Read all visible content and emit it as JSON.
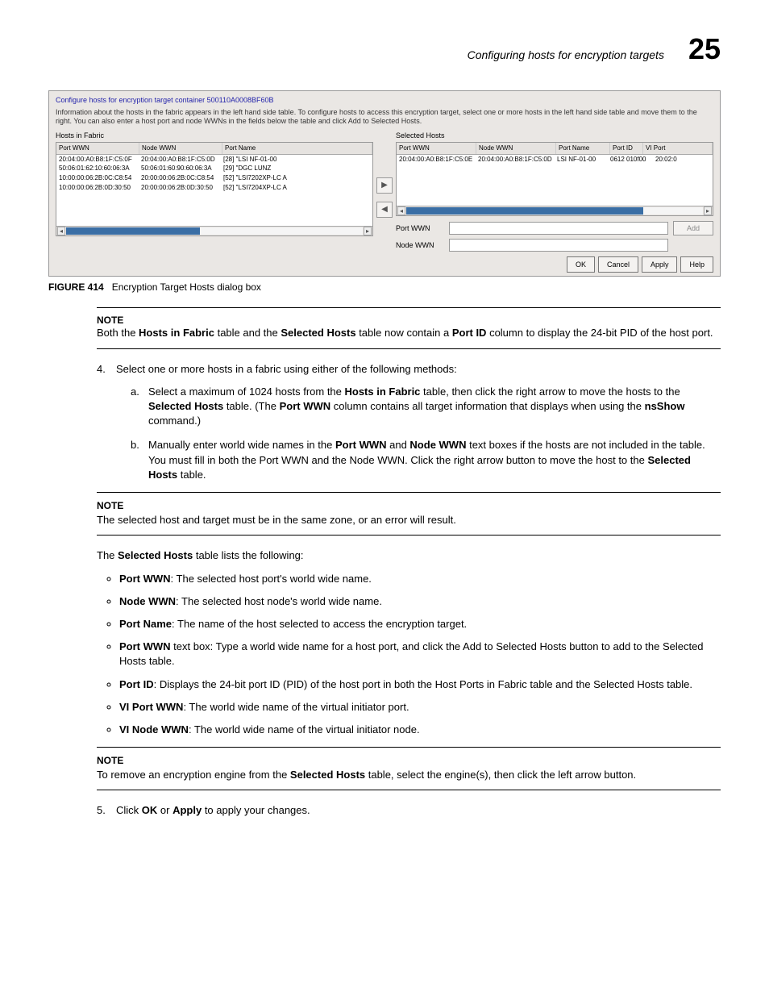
{
  "header": {
    "title": "Configuring hosts for encryption targets",
    "chapter": "25"
  },
  "dialog": {
    "container_line": "Configure hosts for encryption target container 500110A0008BF60B",
    "info_line": "Information about the hosts in the fabric appears in the left hand side table. To configure hosts to access this encryption target, select one or more hosts in the left hand side table and move them to the right. You can also enter a host port and node WWNs in the fields below the table and click Add to Selected Hosts.",
    "left": {
      "label": "Hosts in Fabric",
      "headers": [
        "Port WWN",
        "Node WWN",
        "Port Name"
      ],
      "rows": [
        [
          "20:04:00:A0:B8:1F:C5:0F",
          "20:04:00:A0:B8:1F:C5:0D",
          "[28] \"LSI    NF-01-00"
        ],
        [
          "50:06:01:62:10:60:06:3A",
          "50:06:01:60:90:60:06:3A",
          "[29] \"DGC   LUNZ"
        ],
        [
          "10:00:00:06:2B:0C:C8:54",
          "20:00:00:06:2B:0C:C8:54",
          "[52] \"LSI7202XP-LC A"
        ],
        [
          "10:00:00:06:2B:0D:30:50",
          "20:00:00:06:2B:0D:30:50",
          "[52] \"LSI7204XP-LC A"
        ]
      ]
    },
    "right": {
      "label": "Selected Hosts",
      "headers": [
        "Port WWN",
        "Node WWN",
        "Port Name",
        "Port ID",
        "VI Port"
      ],
      "rows": [
        [
          "20:04:00:A0:B8:1F:C5:0E",
          "20:04:00:A0:B8:1F:C5:0D",
          "LSI    NF-01-00",
          "0612   010f00",
          "20:02:0"
        ]
      ]
    },
    "fields": {
      "port_wwn_label": "Port WWN",
      "node_wwn_label": "Node WWN",
      "add_label": "Add"
    },
    "buttons": {
      "ok": "OK",
      "cancel": "Cancel",
      "apply": "Apply",
      "help": "Help"
    }
  },
  "figure": {
    "label": "FIGURE 414",
    "caption": "Encryption Target Hosts dialog box"
  },
  "note1": {
    "label": "NOTE",
    "text_parts": [
      "Both the ",
      "Hosts in Fabric",
      " table and the ",
      "Selected Hosts",
      " table now contain a ",
      "Port ID",
      " column to display the 24-bit PID of the host port."
    ]
  },
  "step4": {
    "text": "Select one or more hosts in a fabric using either of the following methods:",
    "a_parts": [
      "Select a maximum of 1024 hosts from the ",
      "Hosts in Fabric",
      " table, then click the right arrow to move the hosts to the ",
      "Selected Hosts",
      " table. (The ",
      "Port WWN",
      " column contains all target information that displays when using the ",
      "nsShow",
      " command.)"
    ],
    "b_parts": [
      "Manually enter world wide names in the ",
      "Port WWN",
      " and ",
      "Node WWN",
      " text boxes if the hosts are not included in the table. You must fill in both the Port WWN and the Node WWN. Click the right arrow button to move the host to the ",
      "Selected Hosts",
      " table."
    ]
  },
  "note2": {
    "label": "NOTE",
    "text": "The selected host and target must be in the same zone, or an error will result."
  },
  "intro_parts": [
    "The ",
    "Selected Hosts",
    " table lists the following:"
  ],
  "bullets": [
    {
      "b": "Port WWN",
      "t": ": The selected host port's world wide name."
    },
    {
      "b": "Node WWN",
      "t": ": The selected host node's world wide name."
    },
    {
      "b": "Port Name",
      "t": ": The name of the host selected to access the encryption target."
    },
    {
      "b": "Port WWN",
      "t": " text box: Type a world wide name for a host port, and click the Add to Selected Hosts button to add to the Selected Hosts table."
    },
    {
      "b": "Port ID",
      "t": ": Displays the 24-bit port ID (PID) of the host port in both the Host Ports in Fabric table and the Selected Hosts table."
    },
    {
      "b": "VI Port WWN",
      "t": ": The world wide name of the virtual initiator port."
    },
    {
      "b": "VI Node WWN",
      "t": ": The world wide name of the virtual initiator node."
    }
  ],
  "note3": {
    "label": "NOTE",
    "text_parts": [
      "To remove an encryption engine from the ",
      "Selected Hosts",
      " table, select the engine(s), then click the left arrow button."
    ]
  },
  "step5_parts": [
    "Click ",
    "OK",
    " or ",
    "Apply",
    " to apply your changes."
  ]
}
